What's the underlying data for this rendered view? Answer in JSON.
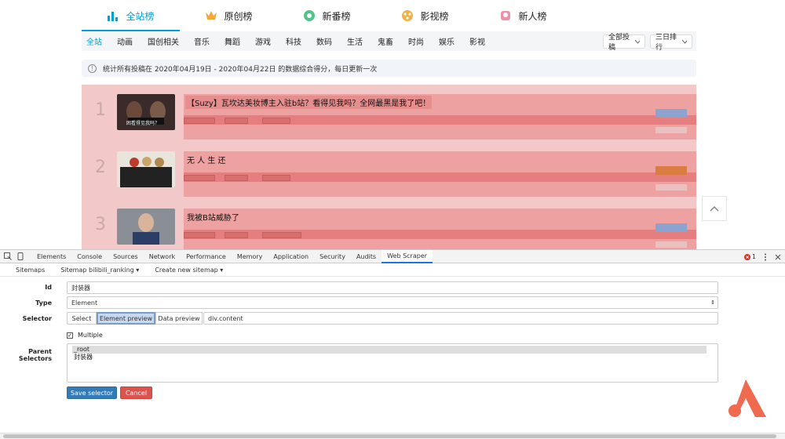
{
  "top_tabs": [
    {
      "label": "全站榜",
      "icon": "bar-chart-icon",
      "active": true
    },
    {
      "label": "原创榜",
      "icon": "crown-icon",
      "active": false
    },
    {
      "label": "新番榜",
      "icon": "bangumi-icon",
      "active": false
    },
    {
      "label": "影视榜",
      "icon": "film-reel-icon",
      "active": false
    },
    {
      "label": "新人榜",
      "icon": "newcomer-icon",
      "active": false
    }
  ],
  "categories": [
    "全站",
    "动画",
    "国创相关",
    "音乐",
    "舞蹈",
    "游戏",
    "科技",
    "数码",
    "生活",
    "鬼畜",
    "时尚",
    "娱乐",
    "影视"
  ],
  "filters": {
    "type": "全部投稿",
    "period": "三日排行"
  },
  "notice": "统计所有投稿在 2020年04月19日 - 2020年04月22日 的数据综合得分，每日更新一次",
  "ranking": [
    {
      "rank": "1",
      "title": "【Suzy】瓦坎达美妆博主入驻b站？看得见我吗？全网最黑是我了吧！",
      "thumb_caption": "困看得见我吗？"
    },
    {
      "rank": "2",
      "title": "无 人 生 还",
      "thumb_caption": ""
    },
    {
      "rank": "3",
      "title": "我被B站威胁了",
      "thumb_caption": ""
    }
  ],
  "devtools": {
    "tabs": [
      "Elements",
      "Console",
      "Sources",
      "Network",
      "Performance",
      "Memory",
      "Application",
      "Security",
      "Audits",
      "Web Scraper"
    ],
    "active_tab": "Web Scraper",
    "error_count": "1",
    "subnav": [
      "Sitemaps",
      "Sitemap bilibili_ranking ▾",
      "Create new sitemap ▾"
    ]
  },
  "form": {
    "id_label": "Id",
    "id_value": "封装器",
    "type_label": "Type",
    "type_value": "Element",
    "selector_label": "Selector",
    "select_btn": "Select",
    "element_preview_btn": "Element preview",
    "data_preview_btn": "Data preview",
    "selector_value": "div.content",
    "multiple_label": "Multiple",
    "multiple_checked": true,
    "parent_label": "Parent Selectors",
    "parents": [
      "_root",
      "封装器"
    ],
    "save_label": "Save selector",
    "cancel_label": "Cancel"
  },
  "colors": {
    "accent": "#00a1d6",
    "highlight": "#f3c8c8",
    "save": "#337ab7",
    "cancel": "#d9534f",
    "logo": "#f06a4f"
  }
}
